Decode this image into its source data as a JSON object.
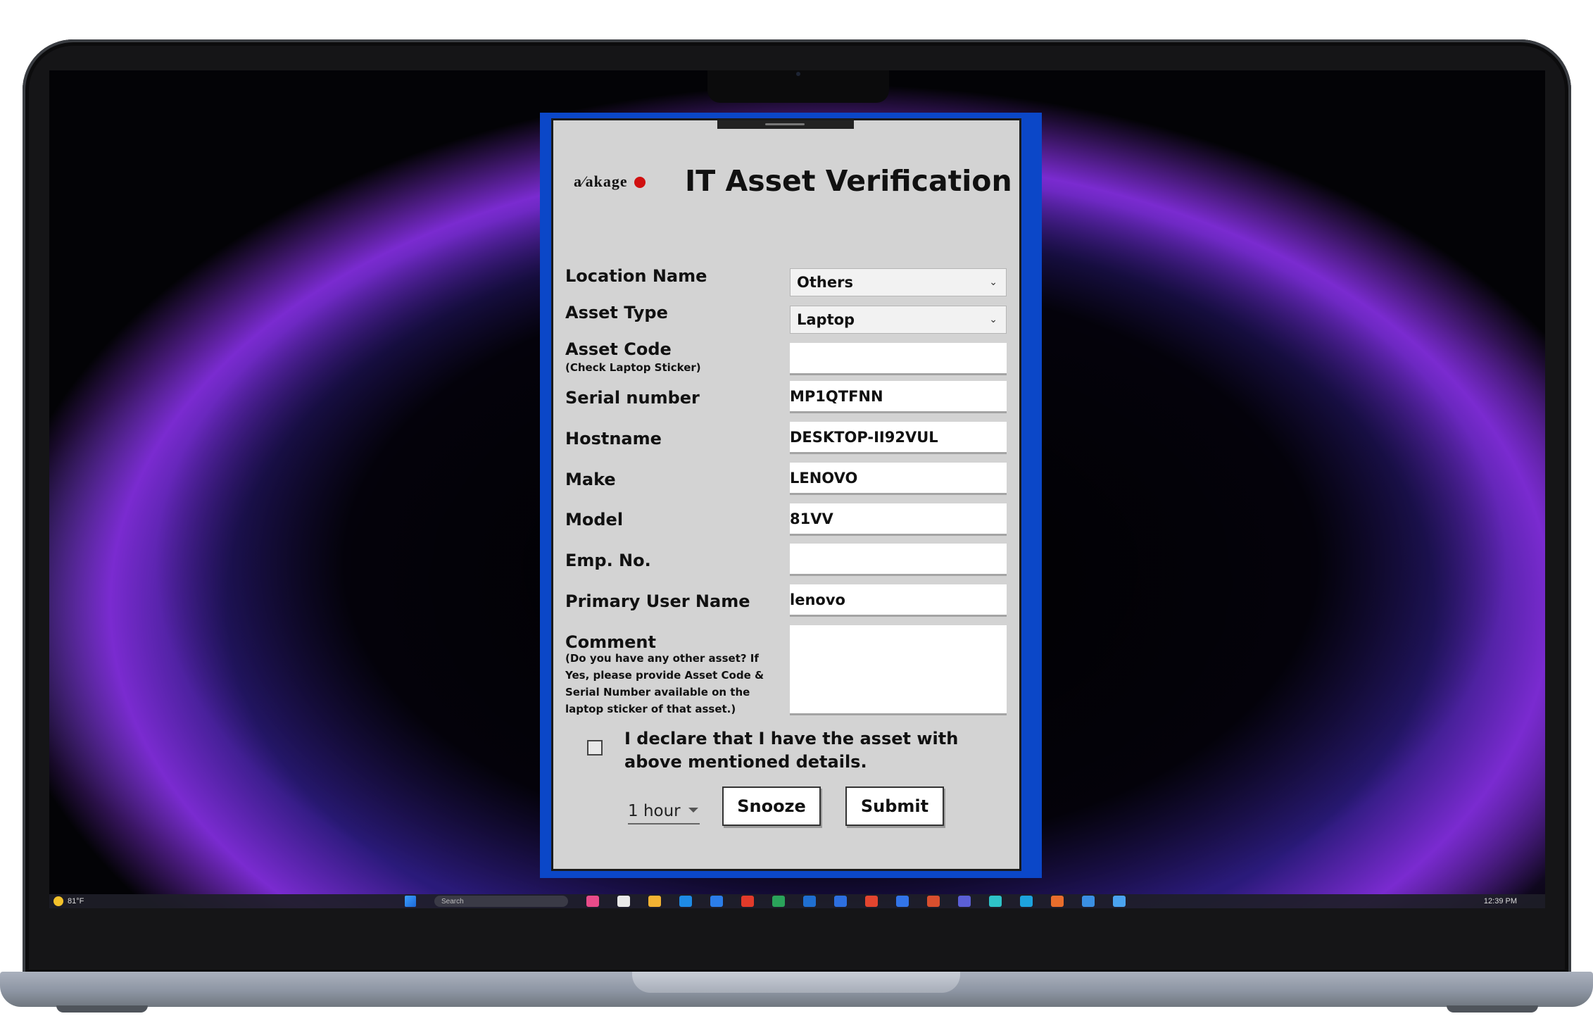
{
  "dialog": {
    "logo_text": "a⁄akage",
    "title": "IT Asset Verification"
  },
  "fields": {
    "location": {
      "label": "Location Name",
      "value": "Others"
    },
    "asset_type": {
      "label": "Asset Type",
      "value": "Laptop"
    },
    "asset_code": {
      "label": "Asset Code",
      "hint": "(Check Laptop Sticker)",
      "value": ""
    },
    "serial": {
      "label": "Serial number",
      "value": "MP1QTFNN"
    },
    "hostname": {
      "label": "Hostname",
      "value": "DESKTOP-II92VUL"
    },
    "make": {
      "label": "Make",
      "value": "LENOVO"
    },
    "model": {
      "label": "Model",
      "value": "81VV"
    },
    "emp_no": {
      "label": "Emp. No.",
      "value": ""
    },
    "primary_user": {
      "label": "Primary User Name",
      "value": "lenovo"
    },
    "comment": {
      "label": "Comment",
      "hint": "(Do you have any other asset? If Yes, please provide Asset Code & Serial Number available on the laptop sticker of that asset.)",
      "value": ""
    }
  },
  "declaration": {
    "checked": false,
    "text": "I declare that I have the asset with above mentioned details."
  },
  "actions": {
    "snooze_duration": "1 hour",
    "snooze_label": "Snooze",
    "submit_label": "Submit"
  },
  "taskbar": {
    "weather": "81°F",
    "search_placeholder": "Search",
    "clock": "12:39 PM"
  },
  "icons": {
    "chevron": "chevron-down-icon",
    "weather": "sun-icon",
    "start": "windows-start-icon"
  }
}
